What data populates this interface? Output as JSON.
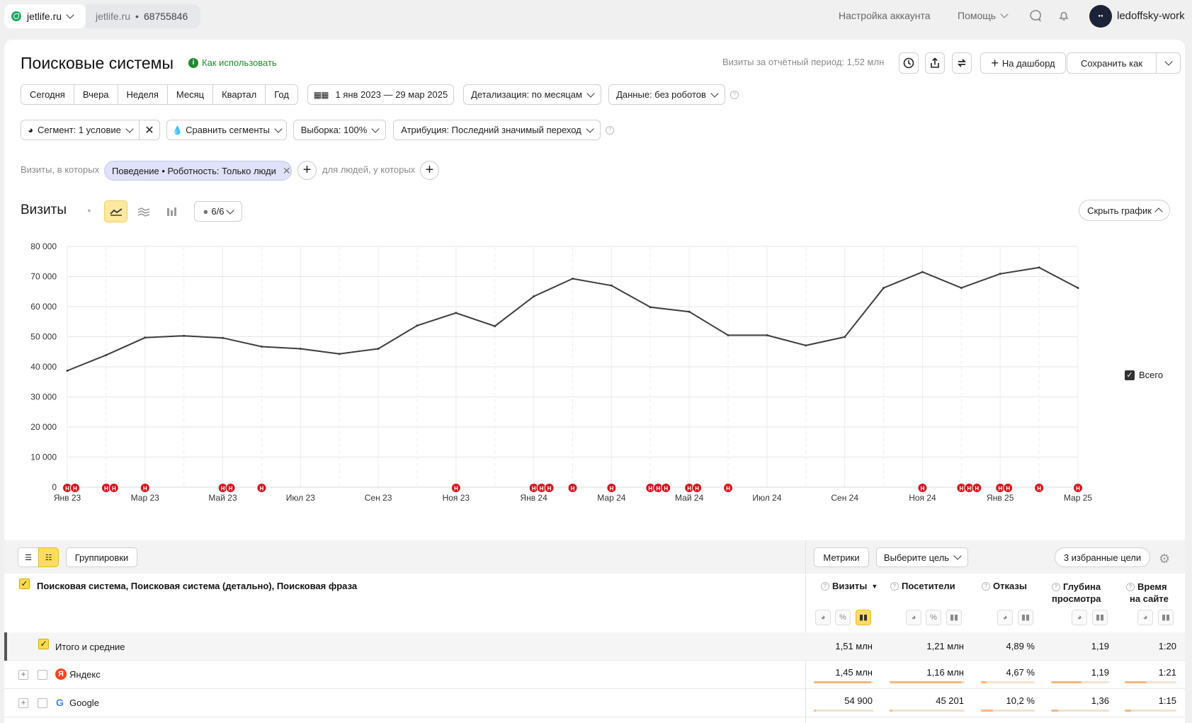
{
  "topbar": {
    "site": "jetlife.ru",
    "counter_site": "jetlife.ru",
    "counter_sep": "•",
    "counter_id": "68755846",
    "account_settings": "Настройка аккаунта",
    "help": "Помощь",
    "username": "ledoffsky-work"
  },
  "header": {
    "title": "Поисковые системы",
    "howto": "Как использовать",
    "period_visits": "Визиты за отчётный период: 1,52 млн",
    "to_dashboard": "На дашборд",
    "save_as": "Сохранить как"
  },
  "period_tabs": [
    "Сегодня",
    "Вчера",
    "Неделя",
    "Месяц",
    "Квартал",
    "Год"
  ],
  "date_range": "1 янв 2023 — 29 мар 2025",
  "detail": "Детализация: по месяцам",
  "data_filter": "Данные: без роботов",
  "segment": "Сегмент: 1 условие",
  "compare_segments": "Сравнить сегменты",
  "sample": "Выборка: 100%",
  "attribution": "Атрибуция: Последний значимый переход",
  "filters": {
    "visits_where": "Визиты, в которых",
    "condition": "Поведение • Роботность: Только люди",
    "for_people": "для людей, у которых"
  },
  "chart_block": {
    "title": "Визиты",
    "annotations_count": "6/6",
    "hide_chart": "Скрыть график",
    "legend_label": "Всего"
  },
  "chart_data": {
    "type": "line",
    "ylim": [
      0,
      80000
    ],
    "yticks": [
      "80 000",
      "70 000",
      "60 000",
      "50 000",
      "40 000",
      "30 000",
      "20 000",
      "10 000",
      "0"
    ],
    "xtick_labels": [
      "Янв 23",
      "Мар 23",
      "Май 23",
      "Июл 23",
      "Сен 23",
      "Ноя 23",
      "Янв 24",
      "Мар 24",
      "Май 24",
      "Июл 24",
      "Сен 24",
      "Ноя 24",
      "Янв 25",
      "Мар 25"
    ],
    "x": [
      "Янв 23",
      "Фев 23",
      "Мар 23",
      "Апр 23",
      "Май 23",
      "Июн 23",
      "Июл 23",
      "Авг 23",
      "Сен 23",
      "Окт 23",
      "Ноя 23",
      "Дек 23",
      "Янв 24",
      "Фев 24",
      "Мар 24",
      "Апр 24",
      "Май 24",
      "Июн 24",
      "Июл 24",
      "Авг 24",
      "Сен 24",
      "Окт 24",
      "Ноя 24",
      "Дек 24",
      "Янв 25",
      "Фев 25",
      "Мар 25"
    ],
    "series": [
      {
        "name": "Всего",
        "color": "#3d3d3d",
        "values": [
          38700,
          43900,
          49700,
          50300,
          49600,
          46700,
          46000,
          44300,
          46000,
          53700,
          57900,
          53500,
          63400,
          69300,
          67000,
          59800,
          58300,
          50500,
          50500,
          47100,
          49900,
          66200,
          71500,
          66200,
          70900,
          73000,
          66200
        ]
      }
    ],
    "annotation_marker": "Н",
    "grid": true,
    "legend_position": "right"
  },
  "table": {
    "groupings": "Группировки",
    "metrics": "Метрики",
    "choose_goal": "Выберите цель",
    "fav_goals": "3 избранные цели",
    "dimension_header": "Поисковая система, Поисковая система (детально), Поисковая фраза",
    "columns": [
      {
        "l1": "Визиты",
        "l2": "",
        "sort": "▼"
      },
      {
        "l1": "Посетители",
        "l2": ""
      },
      {
        "l1": "Отказы",
        "l2": ""
      },
      {
        "l1": "Глубина",
        "l2": "просмотра"
      },
      {
        "l1": "Время",
        "l2": "на сайте"
      }
    ],
    "total": {
      "label": "Итого и средние",
      "values": [
        "1,51 млн",
        "1,21 млн",
        "4,89 %",
        "1,19",
        "1:20"
      ]
    },
    "rows": [
      {
        "label": "Яндекс",
        "icon": "yandex-icon",
        "values": [
          "1,45 млн",
          "1,16 млн",
          "4,67 %",
          "1,19",
          "1:21"
        ],
        "fill": [
          0.96,
          0.96,
          0.1,
          0.52,
          0.43
        ]
      },
      {
        "label": "Google",
        "icon": "google-icon",
        "values": [
          "54 900",
          "45 201",
          "10,2 %",
          "1,36",
          "1:15"
        ],
        "fill": [
          0.04,
          0.04,
          0.22,
          0.12,
          0.12
        ]
      }
    ]
  }
}
